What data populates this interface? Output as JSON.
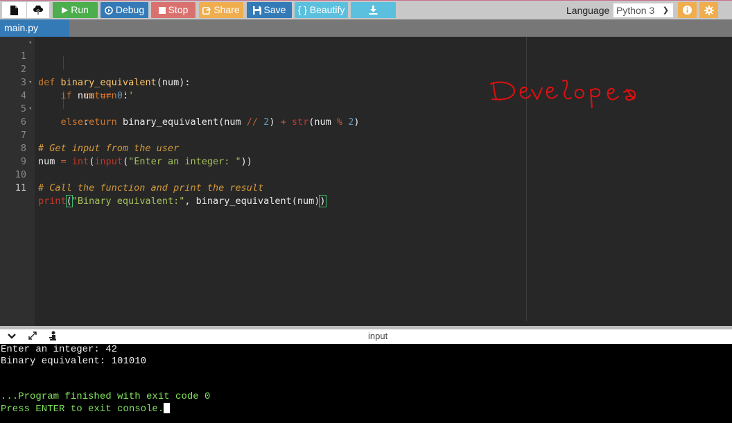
{
  "toolbar": {
    "new_file_icon": "file-icon",
    "upload_icon": "cloud-upload-icon",
    "run_label": "Run",
    "debug_label": "Debug",
    "stop_label": "Stop",
    "share_label": "Share",
    "save_label": "Save",
    "beautify_label": "{ } Beautify",
    "download_icon": "download-icon",
    "language_label": "Language",
    "language_value": "Python 3",
    "info_icon": "info-icon",
    "settings_icon": "gear-icon",
    "colors": {
      "run": "#4cae4c",
      "debug": "#337ab7",
      "stop": "#d9726f",
      "share": "#f0ad4e",
      "save": "#337ab7",
      "beautify": "#5bc0de"
    }
  },
  "tabs": [
    {
      "label": "main.py",
      "active": true
    }
  ],
  "editor": {
    "line_numbers": [
      "1",
      "2",
      "3",
      "4",
      "5",
      "6",
      "7",
      "8",
      "9",
      "10",
      "11"
    ],
    "lines": [
      "def binary_equivalent(num):",
      "    if num == 0:",
      "        return ''",
      "    else:",
      "        return binary_equivalent(num // 2) + str(num % 2)",
      "",
      "# Get input from the user",
      "num = int(input(\"Enter an integer: \"))",
      "",
      "# Call the function and print the result",
      "print(\"Binary equivalent:\", binary_equivalent(num))"
    ],
    "tokens": {
      "def": "def",
      "fname": "binary_equivalent",
      "param": "(num):",
      "if": "if",
      "num": "num",
      "eq": "==",
      "zero": "0",
      "colon": ":",
      "return": "return",
      "empty_str": "''",
      "else": "else",
      "call_open": "binary_equivalent(num ",
      "floordiv": "//",
      "two": "2",
      "close": ")",
      "plus": "+",
      "str": "str",
      "num_open": "(num ",
      "mod": "%",
      "comment1": "# Get input from the user",
      "num_assign": "num ",
      "assign": "=",
      "int": "int",
      "paren": "(",
      "input": "input",
      "prompt": "\"Enter an integer: \"",
      "dbl_close": "))",
      "comment2": "# Call the function and print the result",
      "print": "print",
      "print_open": "(",
      "print_str": "\"Binary equivalent:\"",
      "print_rest": ", binary_equivalent(num)",
      "print_close": ")"
    },
    "annotation_text": "Developer"
  },
  "console": {
    "title": "input",
    "collapse_icon": "chevron-down-icon",
    "expand_icon": "expand-icon",
    "clear_icon": "clear-console-icon",
    "output": [
      "Enter an integer: 42",
      "Binary equivalent: 101010",
      "",
      "",
      "...Program finished with exit code 0",
      "Press ENTER to exit console."
    ]
  }
}
